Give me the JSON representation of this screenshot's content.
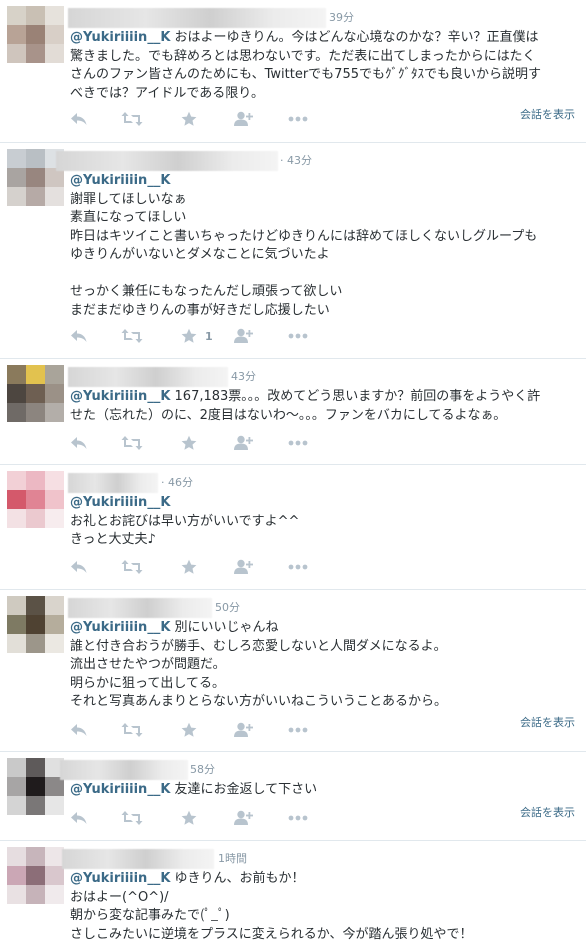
{
  "tweets": [
    {
      "time": "39分",
      "mention": "@Yukiriiiin__K",
      "lines": [
        "おはよーゆきりん。今はどんな心境なのかな？辛い？正直僕は",
        "驚きました。でも辞めろとは思わないです。ただ表に出てしまったからにはたく",
        "さんのファン皆さんのためにも、Twitterでも755でもｸﾞｸﾞﾀｽでも良いから説明す",
        "べきでは？アイドルである限り。"
      ],
      "conversation": "会話を表示",
      "avatar": [
        "#d7d2c8",
        "#c9c0b4",
        "#e6e2dc",
        "#b8a396",
        "#9a8276",
        "#d8cfc7",
        "#cfc5bd",
        "#a8938a",
        "#e2dcd6"
      ]
    },
    {
      "time": "· 43分",
      "mention": "@Yukiriiiin__K",
      "lines": [
        "謝罪してほしいなぁ",
        "素直になってほしい",
        "昨日はキツイこと書いちゃったけどゆきりんには辞めてほしくないしグループも",
        "ゆきりんがいないとダメなことに気づいたよ",
        "",
        "せっかく兼任にもなったんだし頑張って欲しい",
        "まだまだゆきりんの事が好きだし応援したい"
      ],
      "fav_count": "1",
      "conversation": "",
      "avatar": [
        "#c8cdd2",
        "#b9bfc4",
        "#dde1e4",
        "#a9a4a1",
        "#98867f",
        "#cfc6c1",
        "#d5d1cd",
        "#b6aaa6",
        "#e4e0de"
      ]
    },
    {
      "time": "43分",
      "mention": "@Yukiriiiin__K",
      "lines": [
        "167,183票。。。改めてどう思いますか？前回の事をようやく許",
        "せた（忘れた）のに、2度目はないわ～。。。ファンをバカにしてるよなぁ。"
      ],
      "conversation": "",
      "avatar": [
        "#8a7a5c",
        "#e2c24f",
        "#a9a49a",
        "#4d4640",
        "#6e5f52",
        "#9b9187",
        "#6f6a66",
        "#8c857f",
        "#b3aea9"
      ]
    },
    {
      "time": "· 46分",
      "mention": "@Yukiriiiin__K",
      "lines": [
        "お礼とお詫びは早い方がいいですよ^^",
        "きっと大丈夫♪"
      ],
      "conversation": "",
      "avatar": [
        "#f2d0d6",
        "#ecb8c3",
        "#f6dfe3",
        "#d4596b",
        "#e08494",
        "#f0c3cb",
        "#f3e1e4",
        "#ebc9cf",
        "#f7ecee"
      ]
    },
    {
      "time": "50分",
      "mention": "@Yukiriiiin__K",
      "lines": [
        " 別にいいじゃんね",
        "誰と付き合おうが勝手、むしろ恋愛しないと人間ダメになるよ。",
        "流出させたやつが問題だ。",
        "明らかに狙って出してる。",
        "それと写真あんまりとらない方がいいねこういうことあるから。"
      ],
      "conversation": "会話を表示",
      "avatar": [
        "#cfcac0",
        "#5b5246",
        "#d9d4cc",
        "#7e7a63",
        "#4f4232",
        "#b5ad9c",
        "#e2dfd8",
        "#9c968a",
        "#ebe8e2"
      ]
    },
    {
      "time": "58分",
      "mention": "@Yukiriiiin__K",
      "lines": [
        " 友達にお金返して下さい"
      ],
      "conversation": "会話を表示",
      "avatar": [
        "#c9c9c9",
        "#5e5a5a",
        "#e0e0e0",
        "#a7a5a5",
        "#1f1b1c",
        "#8b8888",
        "#d4d4d4",
        "#7a7777",
        "#e6e6e6"
      ]
    },
    {
      "time": "1時間",
      "mention": "@Yukiriiiin__K",
      "lines": [
        " ゆきりん、お前もか！",
        "おはよー(^O^)/",
        "朝から変な記事みたで(ﾟ_ﾟ)",
        "さしこみたいに逆境をプラスに変えられるか、今が踏ん張り処やで！"
      ],
      "conversation": "",
      "avatar": [
        "#e6dde0",
        "#c7b5bb",
        "#ede6e8",
        "#cba7b5",
        "#8c6e78",
        "#d9c7cd",
        "#e9e1e3",
        "#c6b3b9",
        "#f0eaec"
      ]
    }
  ]
}
